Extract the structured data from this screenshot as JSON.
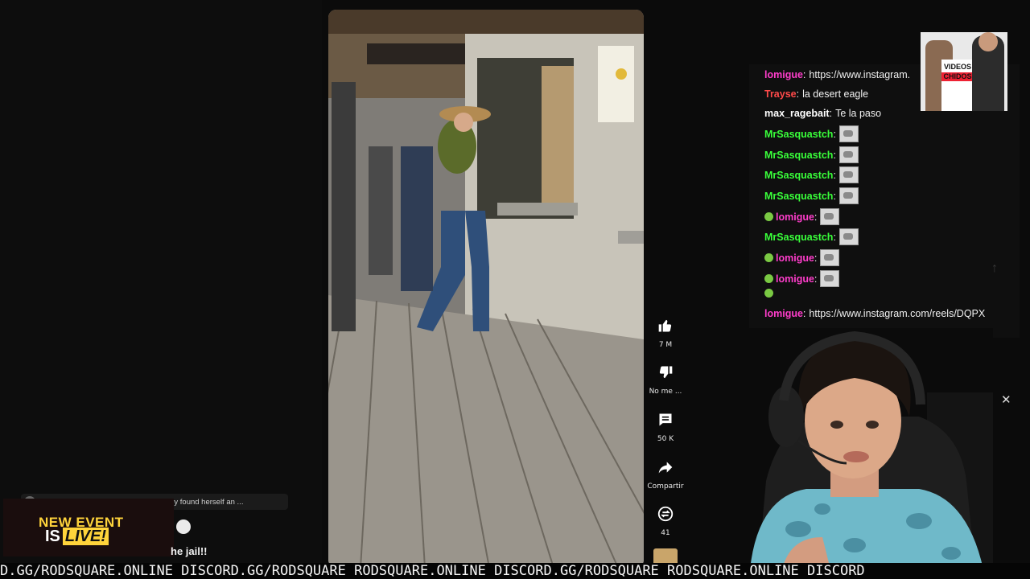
{
  "chat": {
    "messages": [
      {
        "user": "lomigue",
        "color": "#ff3dcb",
        "text": "https://www.instagram.",
        "emote": false,
        "smile": false
      },
      {
        "user": "Trayse",
        "color": "#ff4a4a",
        "text": "la desert eagle",
        "emote": false,
        "smile": false
      },
      {
        "user": "max_ragebait",
        "color": "#ffffff",
        "text": "Te la paso",
        "emote": false,
        "smile": false
      },
      {
        "user": "MrSasquastch",
        "color": "#39ff3a",
        "text": "",
        "emote": true,
        "smile": false
      },
      {
        "user": "MrSasquastch",
        "color": "#39ff3a",
        "text": "",
        "emote": true,
        "smile": false
      },
      {
        "user": "MrSasquastch",
        "color": "#39ff3a",
        "text": "",
        "emote": true,
        "smile": false
      },
      {
        "user": "MrSasquastch",
        "color": "#39ff3a",
        "text": "",
        "emote": true,
        "smile": false
      },
      {
        "user": "lomigue",
        "color": "#ff3dcb",
        "text": "",
        "emote": true,
        "smile": true
      },
      {
        "user": "MrSasquastch",
        "color": "#39ff3a",
        "text": "",
        "emote": true,
        "smile": false
      },
      {
        "user": "lomigue",
        "color": "#ff3dcb",
        "text": "",
        "emote": true,
        "smile": true
      },
      {
        "user": "lomigue",
        "color": "#ff3dcb",
        "text": "",
        "emote": true,
        "smile": true
      },
      {
        "user": "",
        "color": "#ffffff",
        "text": "",
        "emote": false,
        "smile": true
      },
      {
        "user": "lomigue",
        "color": "#ff3dcb",
        "text": "https://www.instagram.com/reels/DQPX",
        "emote": false,
        "smile": false
      }
    ]
  },
  "actions": {
    "like_count": "7 M",
    "dislike_label": "No me ...",
    "comments_count": "50 K",
    "share_label": "Compartir",
    "remix_count": "41"
  },
  "thumb": {
    "line1": "VIDEOS",
    "line2": "CHIDOS"
  },
  "overlay": {
    "comment_text": "I'm glad to see that Jesse from Toy Story found herself an ...",
    "event_line1": "NEW EVENT",
    "event_is": "IS",
    "event_live": "LIVE!",
    "jail_text": "he jail!!"
  },
  "ticker": {
    "text": "D.GG/RODSQUARE.ONLINE DISCORD.GG/RODSQUARE RODSQUARE.ONLINE DISCORD.GG/RODSQUARE RODSQUARE.ONLINE DISCORD"
  },
  "colors": {
    "accent_yellow": "#ffd43b",
    "user_green": "#39ff3a",
    "user_pink": "#ff3dcb"
  }
}
